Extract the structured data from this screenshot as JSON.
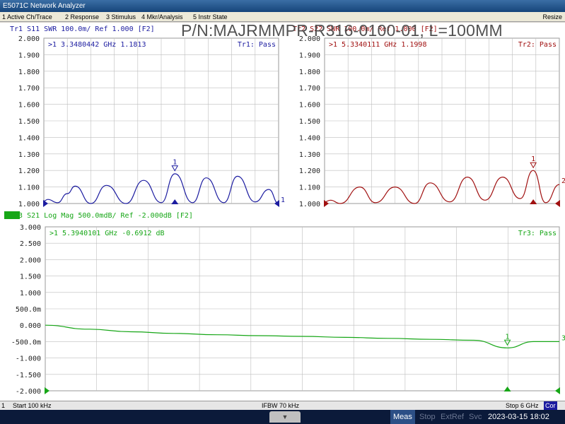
{
  "window": {
    "title": "E5071C Network Analyzer"
  },
  "menu": [
    "1 Active Ch/Trace",
    "2 Response",
    "3 Stimulus",
    "4 Mkr/Analysis",
    "5 Instr State"
  ],
  "menu_resize": "Resize",
  "part_number": "P/N:MAJRMMPR-R316-0100-01, L=100MM",
  "colors": {
    "tr1": "#1c1ca0",
    "tr2": "#a01010",
    "tr3": "#16a616",
    "grid": "#bdbdbd"
  },
  "status": {
    "channel": "1",
    "start": "Start 100 kHz",
    "ifbw": "IFBW 70 kHz",
    "stop": "Stop 6 GHz",
    "cor": "Cor"
  },
  "bottom": {
    "tab_icon": "▼",
    "meas": "Meas",
    "stop": "Stop",
    "extref": "ExtRef",
    "svc": "Svc",
    "datetime": "2023-03-15 18:02"
  },
  "chart_data": [
    {
      "type": "line",
      "trace": "Tr1",
      "header": "Tr1  S11  SWR 100.0m/ Ref 1.000 [F2]",
      "marker_readout": ">1  3.3480442 GHz  1.1813",
      "limit_status": "Tr1: Pass",
      "yticks": [
        "2.000",
        "1.900",
        "1.800",
        "1.700",
        "1.600",
        "1.500",
        "1.400",
        "1.300",
        "1.200",
        "1.100",
        "1.000"
      ],
      "ylim": [
        1.0,
        2.0
      ],
      "xlim_ghz": [
        0.0001,
        6.0
      ],
      "series": [
        {
          "x": [
            0.0001,
            0.1,
            0.35,
            0.6,
            0.8,
            1.2,
            1.6,
            2.1,
            2.55,
            3.0,
            3.35,
            3.8,
            4.15,
            4.6,
            4.95,
            5.4,
            5.75,
            6.0
          ],
          "values": [
            1.015,
            1.025,
            1.005,
            1.06,
            1.105,
            1.0,
            1.11,
            1.0,
            1.14,
            1.005,
            1.18,
            1.005,
            1.155,
            1.005,
            1.165,
            1.01,
            1.085,
            1.0
          ]
        }
      ],
      "marker": {
        "label": "1",
        "x": 3.348,
        "y": 1.1813
      },
      "end_marker_label": "1"
    },
    {
      "type": "line",
      "trace": "Tr2",
      "header": "Tr2  S22  SWR 100.0m/ Ref 1.000 [F2]",
      "marker_readout": ">1  5.3340111 GHz  1.1998",
      "limit_status": "Tr2: Pass",
      "yticks": [
        "2.000",
        "1.900",
        "1.800",
        "1.700",
        "1.600",
        "1.500",
        "1.400",
        "1.300",
        "1.200",
        "1.100",
        "1.000"
      ],
      "ylim": [
        1.0,
        2.0
      ],
      "xlim_ghz": [
        0.0001,
        6.0
      ],
      "series": [
        {
          "x": [
            0.0001,
            0.15,
            0.4,
            0.9,
            1.3,
            1.8,
            2.3,
            2.7,
            3.2,
            3.65,
            4.1,
            4.55,
            5.0,
            5.33,
            5.65,
            6.0
          ],
          "values": [
            1.01,
            1.02,
            1.0,
            1.1,
            1.005,
            1.1,
            1.0,
            1.125,
            1.01,
            1.16,
            1.02,
            1.16,
            1.03,
            1.1998,
            1.005,
            1.115
          ]
        }
      ],
      "marker": {
        "label": "1",
        "x": 5.334,
        "y": 1.1998
      },
      "end_marker_label": "2"
    },
    {
      "type": "line",
      "trace": "Tr3",
      "header": "Tr3  S21  Log Mag 500.0mdB/ Ref -2.000dB [F2]",
      "marker_readout": ">1  5.3940101 GHz  -0.6912 dB",
      "limit_status": "Tr3: Pass",
      "yticks": [
        "3.000",
        "2.500",
        "2.000",
        "1.500",
        "1.000",
        "500.0m",
        "0.000",
        "-500.0m",
        "-1.000",
        "-1.500",
        "-2.000"
      ],
      "ylim": [
        -2.0,
        3.0
      ],
      "xlim_ghz": [
        0.0001,
        6.0
      ],
      "series": [
        {
          "x": [
            0.0001,
            0.5,
            1.0,
            1.5,
            2.0,
            2.5,
            3.0,
            3.5,
            4.0,
            4.5,
            5.0,
            5.394,
            5.7,
            6.0
          ],
          "values": [
            0.0,
            -0.12,
            -0.2,
            -0.25,
            -0.29,
            -0.32,
            -0.34,
            -0.37,
            -0.4,
            -0.43,
            -0.46,
            -0.6912,
            -0.5,
            -0.5
          ]
        }
      ],
      "marker": {
        "label": "1",
        "x": 5.394,
        "y": -0.6912
      },
      "end_marker_label": "3"
    }
  ]
}
